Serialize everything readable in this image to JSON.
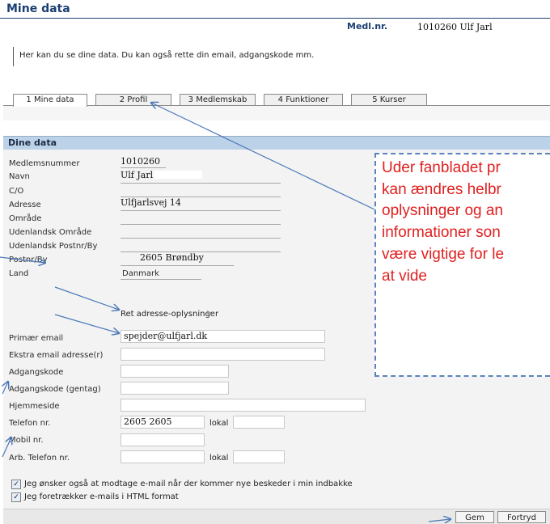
{
  "page": {
    "title": "Mine data",
    "medl_label": "Medl.nr.",
    "medl_value": "1010260  Ulf Jarl"
  },
  "intro": "Her kan du se dine data. Du kan også rette din email, adgangskode mm.",
  "tabs": [
    "1 Mine data",
    "2 Profil",
    "3 Medlemskab",
    "4 Funktioner",
    "5 Kurser"
  ],
  "section_title": "Dine data",
  "fields": {
    "medlemsnummer": {
      "label": "Medlemsnummer",
      "value": "1010260"
    },
    "navn": {
      "label": "Navn",
      "value": "Ulf Jarl"
    },
    "co": {
      "label": "C/O",
      "value": ""
    },
    "adresse": {
      "label": "Adresse",
      "value": "Ulfjarlsvej 14"
    },
    "omraade": {
      "label": "Område",
      "value": ""
    },
    "udl_omraade": {
      "label": "Udenlandsk Område",
      "value": ""
    },
    "udl_postnr": {
      "label": "Udenlandsk Postnr/By",
      "value": ""
    },
    "postnr": {
      "label": "Postnr/By",
      "value": "2605  Brøndby"
    },
    "land": {
      "label": "Land",
      "value": "Danmark"
    }
  },
  "ret_link": "Ret adresse-oplysninger",
  "inputs": {
    "primaer_email": {
      "label": "Primær email",
      "value": "spejder@ulfjarl.dk"
    },
    "ekstra_email": {
      "label": "Ekstra email adresse(r)",
      "value": ""
    },
    "adgangskode": {
      "label": "Adgangskode",
      "value": ""
    },
    "adgangskode_gentag": {
      "label": "Adgangskode (gentag)",
      "value": ""
    },
    "hjemmeside": {
      "label": "Hjemmeside",
      "value": ""
    },
    "telefon": {
      "label": "Telefon nr.",
      "value": "2605 2605"
    },
    "mobil": {
      "label": "Mobil nr.",
      "value": ""
    },
    "arb_telefon": {
      "label": "Arb. Telefon nr.",
      "value": ""
    },
    "lokal_label": "lokal"
  },
  "checkboxes": [
    {
      "label": "Jeg ønsker også at modtage e-mail når der kommer nye beskeder i min indbakke",
      "checked": true
    },
    {
      "label": "Jeg foretrækker e-mails i HTML format",
      "checked": true
    }
  ],
  "buttons": {
    "save": "Gem",
    "cancel": "Fortryd"
  },
  "callout": {
    "lines": [
      "Uder fanbladet pr",
      "kan ændres helbr",
      "oplysninger og an",
      "informationer son",
      "være vigtige for le",
      "at vide"
    ],
    "color": "#e02020",
    "border_color": "#5b82c0"
  },
  "colors": {
    "heading": "#1c3f73",
    "section_bg": "#bcd2e8",
    "arrow": "#4a78b8"
  }
}
